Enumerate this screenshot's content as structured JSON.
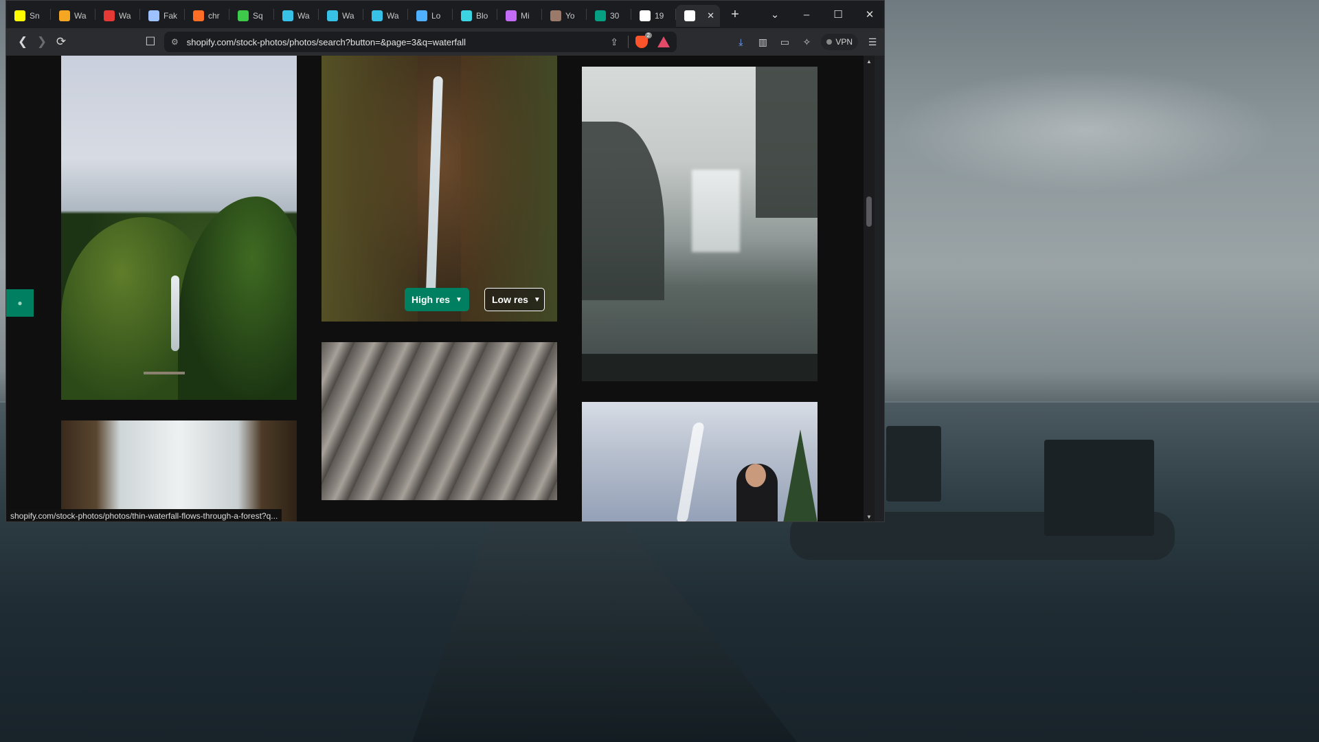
{
  "tabs": [
    {
      "label": "Sn",
      "icon": "snapchat-icon",
      "color": "#fffc00"
    },
    {
      "label": "Wa",
      "icon": "hd-icon",
      "color": "#f5a623"
    },
    {
      "label": "Wa",
      "icon": "red-grid-icon",
      "color": "#e53935"
    },
    {
      "label": "Fak",
      "icon": "document-icon",
      "color": "#9ec1ff"
    },
    {
      "label": "chr",
      "icon": "gitlab-icon",
      "color": "#fc6d26"
    },
    {
      "label": "Sq",
      "icon": "play-icon",
      "color": "#3ec94b"
    },
    {
      "label": "Wa",
      "icon": "s-logo-icon",
      "color": "#37c1e6"
    },
    {
      "label": "Wa",
      "icon": "s-logo-icon",
      "color": "#37c1e6"
    },
    {
      "label": "Wa",
      "icon": "s-logo-icon",
      "color": "#37c1e6"
    },
    {
      "label": "Lo",
      "icon": "cloud-icon",
      "color": "#4fb0ff"
    },
    {
      "label": "Blo",
      "icon": "b-square-icon",
      "color": "#3bd4e0"
    },
    {
      "label": "Mi",
      "icon": "copilot-icon",
      "color": "#c46cf7"
    },
    {
      "label": "Yo",
      "icon": "photo-avatar-icon",
      "color": "#9c7a6a"
    },
    {
      "label": "30",
      "icon": "px-icon",
      "color": "#05a081"
    },
    {
      "label": "19",
      "icon": "is-icon",
      "color": "#ffffff"
    },
    {
      "label": "",
      "icon": "b-bold-icon",
      "color": "#ffffff",
      "active": true
    }
  ],
  "window": {
    "minimize": "–",
    "maximize": "☐",
    "close": "✕",
    "new_tab": "+",
    "tab_list": "⌄"
  },
  "toolbar": {
    "url": "shopify.com/stock-photos/photos/search?button=&page=3&q=waterfall",
    "vpn_label": "VPN",
    "brave_badge": "2"
  },
  "page": {
    "high_res_label": "High res",
    "low_res_label": "Low res",
    "status_url": "shopify.com/stock-photos/photos/thin-waterfall-flows-through-a-forest?q..."
  }
}
